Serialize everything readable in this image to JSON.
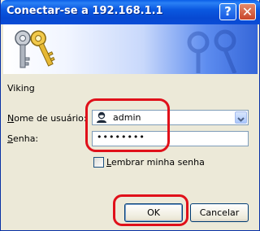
{
  "window": {
    "title": "Conectar-se a 192.168.1.1"
  },
  "titlebar": {
    "help_glyph": "?",
    "close_glyph": "✕"
  },
  "dialog": {
    "realm": "Viking",
    "username_label": "Nome de usuário:",
    "username_value": "admin",
    "password_label": "Senha:",
    "password_value": "••••••••",
    "remember_label": "Lembrar minha senha",
    "remember_checked": false,
    "ok_label": "OK",
    "cancel_label": "Cancelar"
  },
  "icons": {
    "banner": "keys-icon",
    "user": "user-icon",
    "dropdown": "chevron-down-icon"
  },
  "colors": {
    "titlebar": "#0a58e0",
    "highlight": "#e0101a",
    "dialog_bg": "#ece9d8"
  }
}
